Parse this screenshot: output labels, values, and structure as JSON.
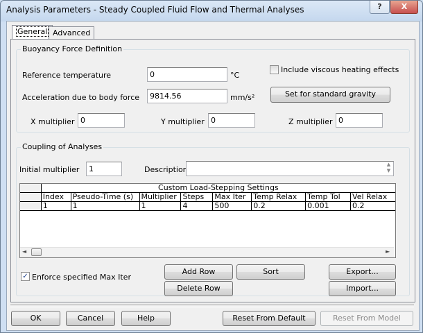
{
  "window": {
    "title": "Analysis Parameters - Steady Coupled Fluid Flow and Thermal Analyses",
    "help_glyph": "?",
    "close_glyph": "X"
  },
  "tabs": [
    {
      "label": "General",
      "active": true
    },
    {
      "label": "Advanced",
      "active": false
    }
  ],
  "buoyancy": {
    "group_label": "Buoyancy Force Definition",
    "ref_temp_label": "Reference temperature",
    "ref_temp_value": "0",
    "ref_temp_unit": "°C",
    "viscous_heating_label": "Include viscous heating effects",
    "viscous_heating_checked": false,
    "accel_label": "Acceleration due to body force",
    "accel_value": "9814.56",
    "accel_unit": "mm/s²",
    "std_gravity_button": "Set for standard gravity",
    "x_mult_label": "X multiplier",
    "x_mult_value": "0",
    "y_mult_label": "Y multiplier",
    "y_mult_value": "0",
    "z_mult_label": "Z multiplier",
    "z_mult_value": "0"
  },
  "coupling": {
    "group_label": "Coupling of Analyses",
    "initial_mult_label": "Initial multiplier",
    "initial_mult_value": "1",
    "description_label": "Description",
    "description_value": "",
    "grid": {
      "caption": "Custom Load-Stepping Settings",
      "columns": [
        "Index",
        "Pseudo-Time (s)",
        "Multiplier",
        "Steps",
        "Max Iter",
        "Temp Relax",
        "Temp Tol",
        "Vel Relax"
      ],
      "rows": [
        [
          "1",
          "1",
          "1",
          "4",
          "500",
          "0.2",
          "0.001",
          "0.2"
        ]
      ]
    },
    "enforce_label": "Enforce specified Max Iter",
    "enforce_checked": true,
    "add_row_button": "Add Row",
    "delete_row_button": "Delete Row",
    "sort_button": "Sort",
    "export_button": "Export...",
    "import_button": "Import..."
  },
  "footer": {
    "ok_button": "OK",
    "cancel_button": "Cancel",
    "help_button": "Help",
    "reset_default_button": "Reset From Default",
    "reset_model_button": "Reset From Model"
  }
}
